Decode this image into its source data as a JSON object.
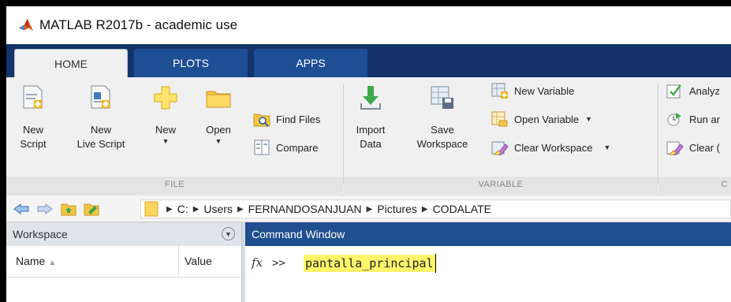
{
  "window": {
    "title": "MATLAB R2017b - academic use",
    "logo_icon": "matlab-logo-icon"
  },
  "tabs": [
    {
      "label": "HOME",
      "active": true
    },
    {
      "label": "PLOTS",
      "active": false
    },
    {
      "label": "APPS",
      "active": false
    }
  ],
  "ribbon": {
    "file": {
      "group_label": "FILE",
      "new_script": {
        "line1": "New",
        "line2": "Script",
        "icon": "new-script-icon"
      },
      "new_live_script": {
        "line1": "New",
        "line2": "Live Script",
        "icon": "new-live-script-icon"
      },
      "new": {
        "line1": "New",
        "icon": "new-plus-icon"
      },
      "open": {
        "line1": "Open",
        "icon": "folder-open-icon"
      },
      "find_files": {
        "label": "Find Files",
        "icon": "find-files-icon"
      },
      "compare": {
        "label": "Compare",
        "icon": "compare-icon"
      }
    },
    "variable": {
      "group_label": "VARIABLE",
      "import_data": {
        "line1": "Import",
        "line2": "Data",
        "icon": "import-arrow-icon"
      },
      "save_workspace": {
        "line1": "Save",
        "line2": "Workspace",
        "icon": "save-workspace-icon"
      },
      "new_variable": {
        "label": "New Variable",
        "icon": "new-variable-icon"
      },
      "open_variable": {
        "label": "Open Variable",
        "icon": "open-variable-icon"
      },
      "clear_workspace": {
        "label": "Clear Workspace",
        "icon": "clear-workspace-icon"
      }
    },
    "code": {
      "group_label": "C",
      "analyze": {
        "label": "Analyz",
        "icon": "analyze-code-icon"
      },
      "run_and_time": {
        "label": "Run ar",
        "icon": "run-and-time-icon"
      },
      "clear_commands": {
        "label": "Clear (",
        "icon": "clear-commands-icon"
      }
    }
  },
  "address_bar": {
    "icons": [
      "back-arrow-icon",
      "forward-arrow-icon",
      "up-folder-icon",
      "browse-folder-icon"
    ],
    "folder_icon": "folder-icon",
    "path": [
      "C:",
      "Users",
      "FERNANDOSANJUAN",
      "Pictures",
      "CODALATE"
    ]
  },
  "workspace": {
    "title": "Workspace",
    "columns": {
      "name": "Name",
      "sort_indicator": "▲",
      "value": "Value"
    }
  },
  "command_window": {
    "title": "Command Window",
    "fx_label": "fx",
    "prompt": ">>",
    "command": "pantalla_principal",
    "highlight_color": "#fff56b"
  },
  "colors": {
    "tab_strip": "#14336b",
    "active_panel_header": "#1f4f8f"
  }
}
